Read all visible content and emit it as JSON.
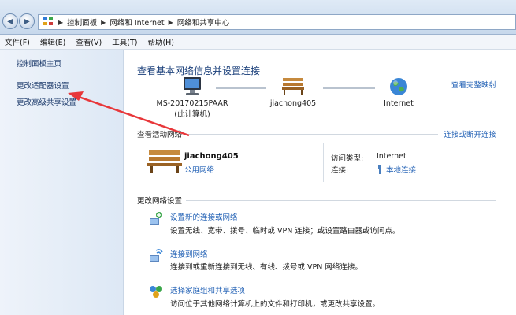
{
  "breadcrumb": [
    "控制面板",
    "网络和 Internet",
    "网络和共享中心"
  ],
  "menu": [
    "文件(F)",
    "编辑(E)",
    "查看(V)",
    "工具(T)",
    "帮助(H)"
  ],
  "sidebar": {
    "items": [
      {
        "label": "控制面板主页"
      },
      {
        "label": "更改适配器设置"
      },
      {
        "label": "更改高级共享设置"
      }
    ]
  },
  "main": {
    "title": "查看基本网络信息并设置连接",
    "full_map_link": "查看完整映射",
    "map": {
      "computer_name": "MS-20170215PAAR",
      "computer_sub": "(此计算机)",
      "network_name": "jiachong405",
      "internet": "Internet"
    },
    "active": {
      "heading": "查看活动网络",
      "change_link": "连接或断开连接",
      "network_name": "jiachong405",
      "network_type": "公用网络",
      "access_type_label": "访问类型:",
      "access_type_value": "Internet",
      "connection_label": "连接:",
      "connection_value": "本地连接"
    },
    "settings": {
      "heading": "更改网络设置",
      "tasks": [
        {
          "link": "设置新的连接或网络",
          "desc": "设置无线、宽带、拨号、临时或 VPN 连接；或设置路由器或访问点。"
        },
        {
          "link": "连接到网络",
          "desc": "连接到或重新连接到无线、有线、拨号或 VPN 网络连接。"
        },
        {
          "link": "选择家庭组和共享选项",
          "desc": "访问位于其他网络计算机上的文件和打印机，或更改共享设置。"
        }
      ]
    }
  },
  "colors": {
    "link": "#1f5fb4",
    "title": "#1a3f7a",
    "annotation_arrow": "#e8373a"
  }
}
